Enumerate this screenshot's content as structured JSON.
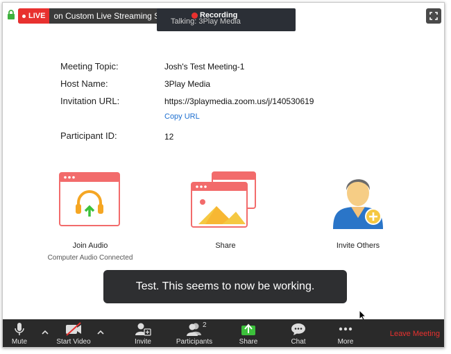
{
  "top": {
    "live_badge": "LIVE",
    "live_service": "on Custom Live Streaming Service",
    "recording": "Recording",
    "talking": "Talking: 3Play Media"
  },
  "meeting": {
    "topic_label": "Meeting Topic:",
    "topic_value": "Josh's Test Meeting-1",
    "host_label": "Host Name:",
    "host_value": "3Play Media",
    "url_label": "Invitation URL:",
    "url_value": "https://3playmedia.zoom.us/j/140530619",
    "copy_url": "Copy URL",
    "participant_label": "Participant ID:",
    "participant_value": "12"
  },
  "actions": {
    "join_audio": "Join Audio",
    "join_audio_sub": "Computer Audio Connected",
    "share": "Share",
    "invite_others": "Invite Others"
  },
  "toast": "Test. This seems to now be working.",
  "toolbar": {
    "mute": "Mute",
    "start_video": "Start Video",
    "invite": "Invite",
    "participants": "Participants",
    "participants_count": "2",
    "share": "Share",
    "chat": "Chat",
    "more": "More",
    "leave": "Leave Meeting"
  },
  "colors": {
    "live_red": "#e8312f",
    "link_blue": "#1d6fd0",
    "tile_red": "#f26b6b",
    "toolbar_bg": "#2a2a2a",
    "share_green": "#3cc13b"
  }
}
